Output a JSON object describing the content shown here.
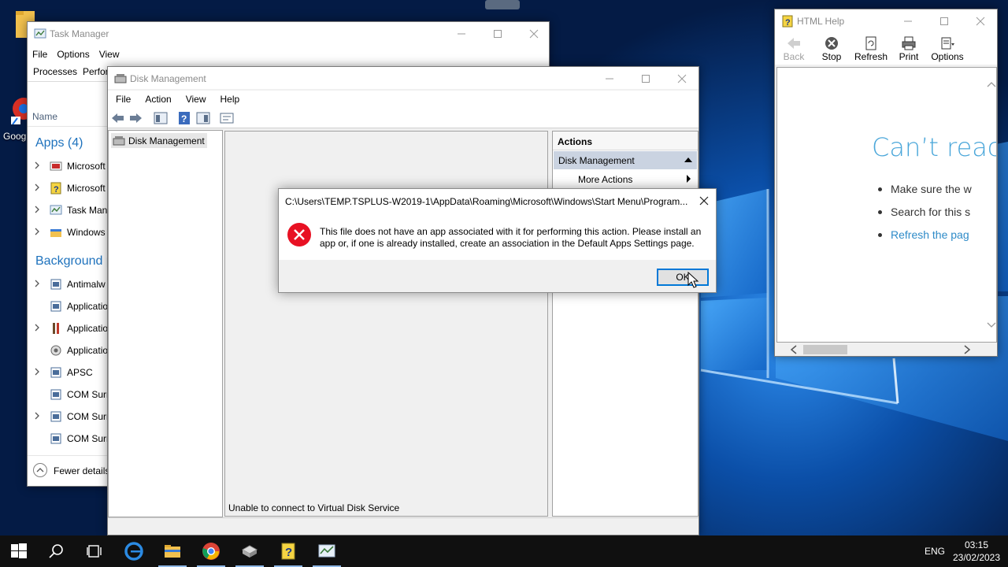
{
  "desktop": {
    "icons": [
      {
        "label": "Goog"
      }
    ]
  },
  "task_manager": {
    "title": "Task Manager",
    "menu": [
      "File",
      "Options",
      "View"
    ],
    "tabs": [
      "Processes",
      "Perfor"
    ],
    "column_name": "Name",
    "apps_section": "Apps (4)",
    "apps": [
      {
        "label": "Microsoft",
        "icon": "microsoft-app-icon"
      },
      {
        "label": "Microsoft",
        "icon": "help-app-icon"
      },
      {
        "label": "Task Man",
        "icon": "task-manager-icon"
      },
      {
        "label": "Windows",
        "icon": "windows-explorer-icon"
      }
    ],
    "background_section": "Background p",
    "background": [
      {
        "label": "Antimalw",
        "expandable": true
      },
      {
        "label": "Applicatio",
        "expandable": false
      },
      {
        "label": "Applicatio",
        "expandable": true
      },
      {
        "label": "Applicatio",
        "expandable": false
      },
      {
        "label": "APSC",
        "expandable": true
      },
      {
        "label": "COM Surr",
        "expandable": false
      },
      {
        "label": "COM Surr",
        "expandable": true
      },
      {
        "label": "COM Surr",
        "expandable": false
      }
    ],
    "fewer_details": "Fewer details"
  },
  "disk_management": {
    "title": "Disk Management",
    "menu": [
      "File",
      "Action",
      "View",
      "Help"
    ],
    "tree_node": "Disk Management",
    "status": "Unable to connect to Virtual Disk Service",
    "actions_header": "Actions",
    "actions_section": "Disk Management",
    "more_actions": "More Actions"
  },
  "html_help": {
    "title": "HTML Help",
    "tools": [
      "Back",
      "Stop",
      "Refresh",
      "Print",
      "Options"
    ],
    "heading": "Can’t reac",
    "bullets": [
      "Make sure the w",
      "Search for this s",
      "Refresh the pag"
    ]
  },
  "dialog": {
    "title": "C:\\Users\\TEMP.TSPLUS-W2019-1\\AppData\\Roaming\\Microsoft\\Windows\\Start Menu\\Program...",
    "message": "This file does not have an app associated with it for performing this action. Please install an app or, if one is already installed, create an association in the Default Apps Settings page.",
    "ok_label": "OK"
  },
  "taskbar": {
    "language": "ENG",
    "time": "03:15",
    "date": "23/02/2023"
  },
  "colors": {
    "accent": "#0078d7",
    "link": "#2e8bc8",
    "section_blue": "#1e72bd",
    "error_red": "#e81123"
  }
}
